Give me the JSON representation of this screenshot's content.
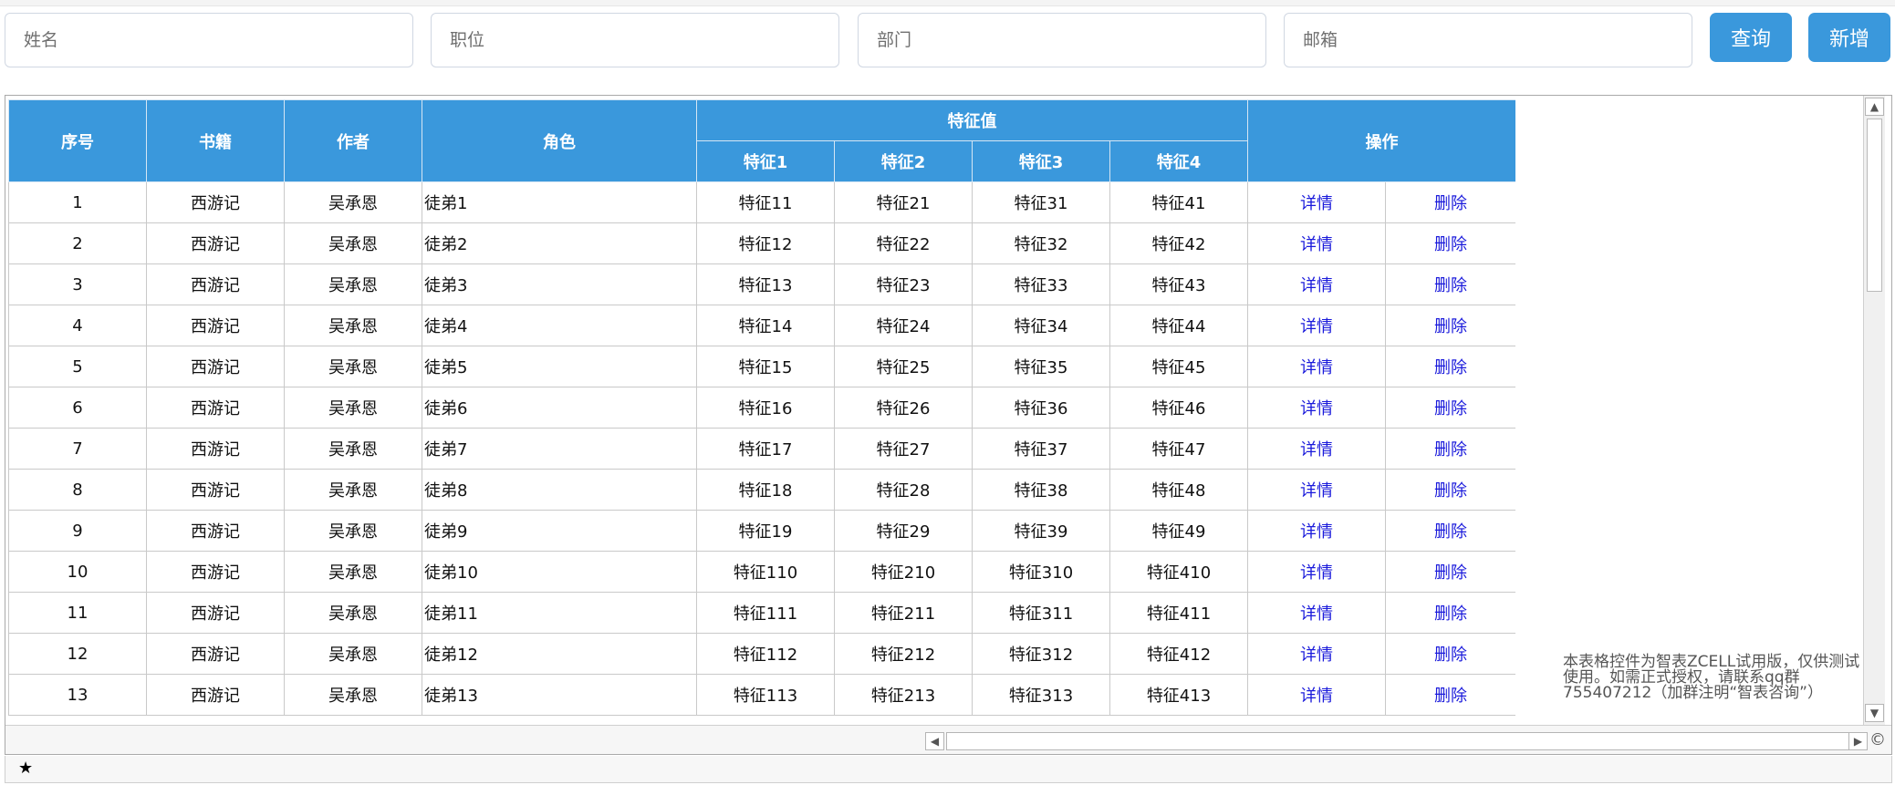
{
  "search": {
    "name_placeholder": "姓名",
    "position_placeholder": "职位",
    "department_placeholder": "部门",
    "email_placeholder": "邮箱",
    "query_label": "查询",
    "add_label": "新增"
  },
  "table": {
    "headers": {
      "index": "序号",
      "book": "书籍",
      "author": "作者",
      "role": "角色",
      "features": "特征值",
      "feature1": "特征1",
      "feature2": "特征2",
      "feature3": "特征3",
      "feature4": "特征4",
      "actions": "操作"
    },
    "rows": [
      {
        "index": "1",
        "book": "西游记",
        "author": "吴承恩",
        "role": "徒弟1",
        "f1": "特征11",
        "f2": "特征21",
        "f3": "特征31",
        "f4": "特征41",
        "detail": "详情",
        "delete": "删除"
      },
      {
        "index": "2",
        "book": "西游记",
        "author": "吴承恩",
        "role": "徒弟2",
        "f1": "特征12",
        "f2": "特征22",
        "f3": "特征32",
        "f4": "特征42",
        "detail": "详情",
        "delete": "删除"
      },
      {
        "index": "3",
        "book": "西游记",
        "author": "吴承恩",
        "role": "徒弟3",
        "f1": "特征13",
        "f2": "特征23",
        "f3": "特征33",
        "f4": "特征43",
        "detail": "详情",
        "delete": "删除"
      },
      {
        "index": "4",
        "book": "西游记",
        "author": "吴承恩",
        "role": "徒弟4",
        "f1": "特征14",
        "f2": "特征24",
        "f3": "特征34",
        "f4": "特征44",
        "detail": "详情",
        "delete": "删除"
      },
      {
        "index": "5",
        "book": "西游记",
        "author": "吴承恩",
        "role": "徒弟5",
        "f1": "特征15",
        "f2": "特征25",
        "f3": "特征35",
        "f4": "特征45",
        "detail": "详情",
        "delete": "删除"
      },
      {
        "index": "6",
        "book": "西游记",
        "author": "吴承恩",
        "role": "徒弟6",
        "f1": "特征16",
        "f2": "特征26",
        "f3": "特征36",
        "f4": "特征46",
        "detail": "详情",
        "delete": "删除"
      },
      {
        "index": "7",
        "book": "西游记",
        "author": "吴承恩",
        "role": "徒弟7",
        "f1": "特征17",
        "f2": "特征27",
        "f3": "特征37",
        "f4": "特征47",
        "detail": "详情",
        "delete": "删除"
      },
      {
        "index": "8",
        "book": "西游记",
        "author": "吴承恩",
        "role": "徒弟8",
        "f1": "特征18",
        "f2": "特征28",
        "f3": "特征38",
        "f4": "特征48",
        "detail": "详情",
        "delete": "删除"
      },
      {
        "index": "9",
        "book": "西游记",
        "author": "吴承恩",
        "role": "徒弟9",
        "f1": "特征19",
        "f2": "特征29",
        "f3": "特征39",
        "f4": "特征49",
        "detail": "详情",
        "delete": "删除"
      },
      {
        "index": "10",
        "book": "西游记",
        "author": "吴承恩",
        "role": "徒弟10",
        "f1": "特征110",
        "f2": "特征210",
        "f3": "特征310",
        "f4": "特征410",
        "detail": "详情",
        "delete": "删除"
      },
      {
        "index": "11",
        "book": "西游记",
        "author": "吴承恩",
        "role": "徒弟11",
        "f1": "特征111",
        "f2": "特征211",
        "f3": "特征311",
        "f4": "特征411",
        "detail": "详情",
        "delete": "删除"
      },
      {
        "index": "12",
        "book": "西游记",
        "author": "吴承恩",
        "role": "徒弟12",
        "f1": "特征112",
        "f2": "特征212",
        "f3": "特征312",
        "f4": "特征412",
        "detail": "详情",
        "delete": "删除"
      },
      {
        "index": "13",
        "book": "西游记",
        "author": "吴承恩",
        "role": "徒弟13",
        "f1": "特征113",
        "f2": "特征213",
        "f3": "特征313",
        "f4": "特征413",
        "detail": "详情",
        "delete": "删除"
      }
    ]
  },
  "watermark": "本表格控件为智表ZCELL试用版，仅供测试使用。如需正式授权，请联系qq群755407212（加群注明“智表咨询”）",
  "footer": {
    "star": "★"
  },
  "scrollbar": {
    "up_icon": "▲",
    "down_icon": "▼",
    "left_icon": "◀",
    "right_icon": "▶",
    "copyright_icon": "©"
  },
  "colors": {
    "header_bg": "#3a98dc",
    "button_bg": "#3a98dc",
    "link": "#1a1adb"
  }
}
